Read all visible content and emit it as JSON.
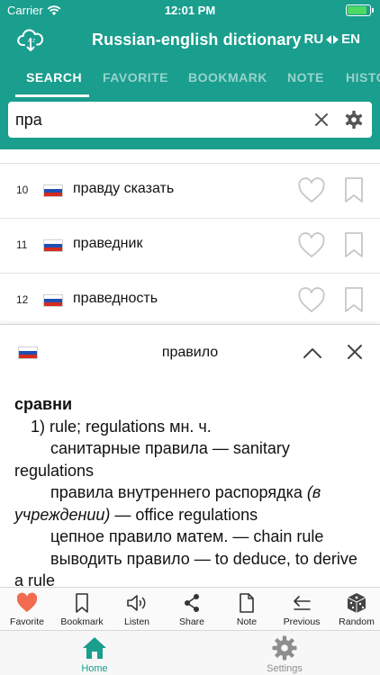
{
  "status_bar": {
    "carrier": "Carrier",
    "time": "12:01 PM"
  },
  "header": {
    "title": "Russian-english dictionary",
    "lang_from": "RU",
    "lang_to": "EN",
    "cloud_icon": "cloud-sync-icon"
  },
  "tabs": [
    {
      "label": "SEARCH",
      "active": true
    },
    {
      "label": "FAVORITE",
      "active": false
    },
    {
      "label": "BOOKMARK",
      "active": false
    },
    {
      "label": "NOTE",
      "active": false
    },
    {
      "label": "HISTO",
      "active": false
    }
  ],
  "search": {
    "value": "пра"
  },
  "results": [
    {
      "num": "10",
      "word": "правду сказать"
    },
    {
      "num": "11",
      "word": "праведник"
    },
    {
      "num": "12",
      "word": "праведность"
    }
  ],
  "detail": {
    "word": "правило",
    "article": {
      "heading": "сравни",
      "sense": "1) rule; regulations мн. ч.",
      "ex1": "санитарные правила — sanitary regulations",
      "ex2_a": "правила внутреннего распорядка ",
      "ex2_em": "(в учреждении)",
      "ex2_b": " — office regulations",
      "ex3": "цепное правило матем. — chain rule",
      "ex4": "выводить правило — to deduce, to derive a rule"
    }
  },
  "toolbar": {
    "favorite": "Favorite",
    "bookmark": "Bookmark",
    "listen": "Listen",
    "share": "Share",
    "note": "Note",
    "previous": "Previous",
    "random": "Random"
  },
  "nav": {
    "home": "Home",
    "settings": "Settings"
  },
  "colors": {
    "primary": "#1a9e8e",
    "favorite_active": "#f26b4f",
    "nav_active": "#1a9e8e",
    "nav_inactive": "#8e8e8e"
  }
}
